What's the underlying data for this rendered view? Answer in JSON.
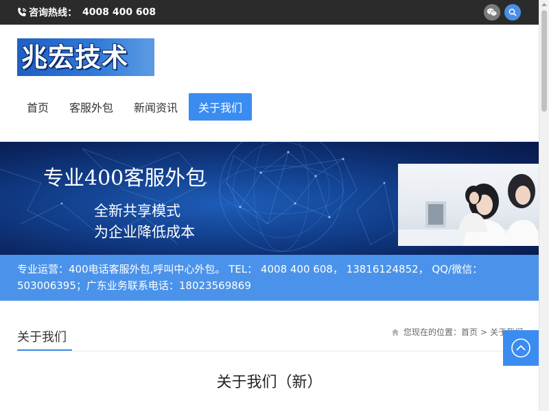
{
  "topbar": {
    "hotline_label": "咨询热线：",
    "hotline_number": "4008 400 608"
  },
  "logo": {
    "text": "兆宏技术"
  },
  "nav": {
    "items": [
      {
        "label": "首页"
      },
      {
        "label": "客服外包"
      },
      {
        "label": "新闻资讯"
      },
      {
        "label": "关于我们",
        "active": true
      }
    ]
  },
  "banner": {
    "title": "专业400客服外包",
    "line1": "全新共享模式",
    "line2": "为企业降低成本"
  },
  "info": {
    "line1": "专业运营：400电话客服外包,呼叫中心外包。 TEL： 4008 400 608， 13816124852， QQ/微信：",
    "line2": "503006395；广东业务联系电话：18023569869"
  },
  "section": {
    "title": "关于我们",
    "breadcrumb_prefix": "您现在的位置：",
    "breadcrumb_home": "首页",
    "breadcrumb_sep": ">",
    "breadcrumb_current": "关于我们"
  },
  "article": {
    "title": "关于我们（新）"
  },
  "colors": {
    "topbar": "#2b2b2b",
    "accent": "#3b8cf0",
    "info_strip": "#4b93ea",
    "banner_dark": "#0b2560"
  },
  "icons": [
    "phone-icon",
    "wechat-icon",
    "search-icon",
    "home-icon",
    "arrow-up-icon"
  ]
}
